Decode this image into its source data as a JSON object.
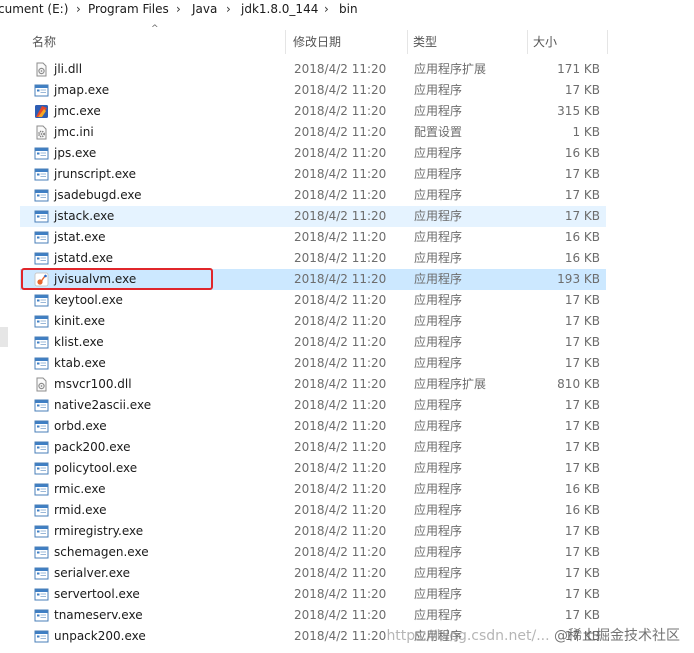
{
  "address_bar": {
    "crumbs": [
      "cument (E:)",
      "Program Files",
      "Java",
      "jdk1.8.0_144",
      "bin"
    ]
  },
  "columns": {
    "name": "名称",
    "date": "修改日期",
    "type": "类型",
    "size": "大小"
  },
  "highlight_color": "#e0262b",
  "files": [
    {
      "name": "jli.dll",
      "date": "2018/4/2 11:20",
      "type": "应用程序扩展",
      "size": "171 KB",
      "icon": "dll-icon",
      "state": ""
    },
    {
      "name": "jmap.exe",
      "date": "2018/4/2 11:20",
      "type": "应用程序",
      "size": "17 KB",
      "icon": "exe-icon",
      "state": ""
    },
    {
      "name": "jmc.exe",
      "date": "2018/4/2 11:20",
      "type": "应用程序",
      "size": "315 KB",
      "icon": "jmc-icon",
      "state": ""
    },
    {
      "name": "jmc.ini",
      "date": "2018/4/2 11:20",
      "type": "配置设置",
      "size": "1 KB",
      "icon": "ini-icon",
      "state": ""
    },
    {
      "name": "jps.exe",
      "date": "2018/4/2 11:20",
      "type": "应用程序",
      "size": "16 KB",
      "icon": "exe-icon",
      "state": ""
    },
    {
      "name": "jrunscript.exe",
      "date": "2018/4/2 11:20",
      "type": "应用程序",
      "size": "17 KB",
      "icon": "exe-icon",
      "state": ""
    },
    {
      "name": "jsadebugd.exe",
      "date": "2018/4/2 11:20",
      "type": "应用程序",
      "size": "17 KB",
      "icon": "exe-icon",
      "state": ""
    },
    {
      "name": "jstack.exe",
      "date": "2018/4/2 11:20",
      "type": "应用程序",
      "size": "17 KB",
      "icon": "exe-icon",
      "state": "hover"
    },
    {
      "name": "jstat.exe",
      "date": "2018/4/2 11:20",
      "type": "应用程序",
      "size": "16 KB",
      "icon": "exe-icon",
      "state": ""
    },
    {
      "name": "jstatd.exe",
      "date": "2018/4/2 11:20",
      "type": "应用程序",
      "size": "16 KB",
      "icon": "exe-icon",
      "state": ""
    },
    {
      "name": "jvisualvm.exe",
      "date": "2018/4/2 11:20",
      "type": "应用程序",
      "size": "193 KB",
      "icon": "jvisualvm-icon",
      "state": "selected"
    },
    {
      "name": "keytool.exe",
      "date": "2018/4/2 11:20",
      "type": "应用程序",
      "size": "17 KB",
      "icon": "exe-icon",
      "state": ""
    },
    {
      "name": "kinit.exe",
      "date": "2018/4/2 11:20",
      "type": "应用程序",
      "size": "17 KB",
      "icon": "exe-icon",
      "state": ""
    },
    {
      "name": "klist.exe",
      "date": "2018/4/2 11:20",
      "type": "应用程序",
      "size": "17 KB",
      "icon": "exe-icon",
      "state": ""
    },
    {
      "name": "ktab.exe",
      "date": "2018/4/2 11:20",
      "type": "应用程序",
      "size": "17 KB",
      "icon": "exe-icon",
      "state": ""
    },
    {
      "name": "msvcr100.dll",
      "date": "2018/4/2 11:20",
      "type": "应用程序扩展",
      "size": "810 KB",
      "icon": "dll-icon",
      "state": ""
    },
    {
      "name": "native2ascii.exe",
      "date": "2018/4/2 11:20",
      "type": "应用程序",
      "size": "17 KB",
      "icon": "exe-icon",
      "state": ""
    },
    {
      "name": "orbd.exe",
      "date": "2018/4/2 11:20",
      "type": "应用程序",
      "size": "17 KB",
      "icon": "exe-icon",
      "state": ""
    },
    {
      "name": "pack200.exe",
      "date": "2018/4/2 11:20",
      "type": "应用程序",
      "size": "17 KB",
      "icon": "exe-icon",
      "state": ""
    },
    {
      "name": "policytool.exe",
      "date": "2018/4/2 11:20",
      "type": "应用程序",
      "size": "17 KB",
      "icon": "exe-icon",
      "state": ""
    },
    {
      "name": "rmic.exe",
      "date": "2018/4/2 11:20",
      "type": "应用程序",
      "size": "16 KB",
      "icon": "exe-icon",
      "state": ""
    },
    {
      "name": "rmid.exe",
      "date": "2018/4/2 11:20",
      "type": "应用程序",
      "size": "16 KB",
      "icon": "exe-icon",
      "state": ""
    },
    {
      "name": "rmiregistry.exe",
      "date": "2018/4/2 11:20",
      "type": "应用程序",
      "size": "17 KB",
      "icon": "exe-icon",
      "state": ""
    },
    {
      "name": "schemagen.exe",
      "date": "2018/4/2 11:20",
      "type": "应用程序",
      "size": "17 KB",
      "icon": "exe-icon",
      "state": ""
    },
    {
      "name": "serialver.exe",
      "date": "2018/4/2 11:20",
      "type": "应用程序",
      "size": "17 KB",
      "icon": "exe-icon",
      "state": ""
    },
    {
      "name": "servertool.exe",
      "date": "2018/4/2 11:20",
      "type": "应用程序",
      "size": "17 KB",
      "icon": "exe-icon",
      "state": ""
    },
    {
      "name": "tnameserv.exe",
      "date": "2018/4/2 11:20",
      "type": "应用程序",
      "size": "17 KB",
      "icon": "exe-icon",
      "state": ""
    },
    {
      "name": "unpack200.exe",
      "date": "2018/4/2 11:20",
      "type": "应用程序",
      "size": "17 KB",
      "icon": "exe-icon",
      "state": ""
    }
  ],
  "watermark": {
    "url": "https://blog.csdn.net/...",
    "brand": "@稀土掘金技术社区"
  }
}
